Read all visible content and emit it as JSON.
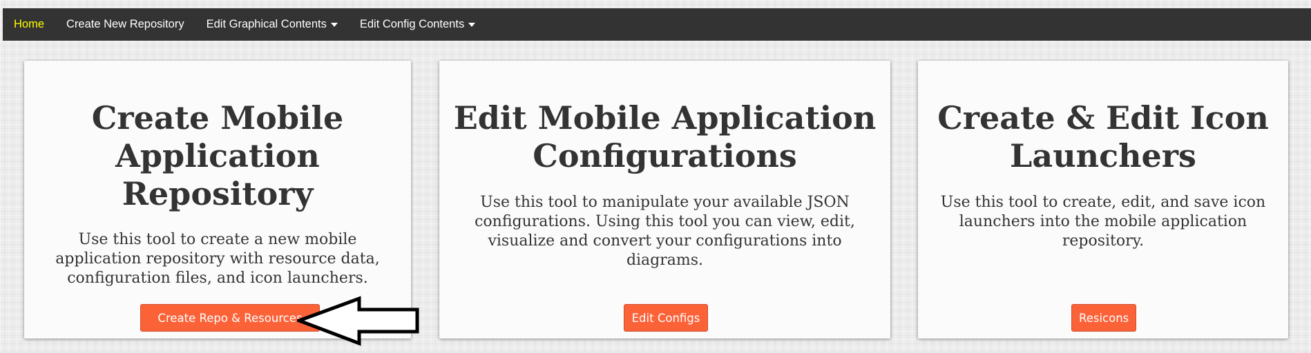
{
  "navbar": {
    "items": [
      {
        "label": "Home",
        "active": true
      },
      {
        "label": "Create New Repository"
      },
      {
        "label": "Edit Graphical Contents",
        "dropdown": true
      },
      {
        "label": "Edit Config Contents",
        "dropdown": true
      }
    ]
  },
  "cards": [
    {
      "title": "Create Mobile Application Repository",
      "description": "Use this tool to create a new mobile application repository with resource data, configuration files, and icon launchers.",
      "button_label": "Create Repo & Resources"
    },
    {
      "title": "Edit Mobile Application Configurations",
      "description": "Use this tool to manipulate your available JSON configurations. Using this tool you can view, edit, visualize and convert your configurations into diagrams.",
      "button_label": "Edit Configs"
    },
    {
      "title": "Create & Edit Icon Launchers",
      "description": "Use this tool to create, edit, and save icon launchers into the mobile application repository.",
      "button_label": "Resicons"
    }
  ],
  "colors": {
    "navbar_bg": "#333333",
    "nav_active": "#ffff00",
    "button_bg": "#fc6238"
  },
  "icons": {
    "annotation_arrow": "left-arrow-icon",
    "dropdown": "caret-down-icon"
  }
}
